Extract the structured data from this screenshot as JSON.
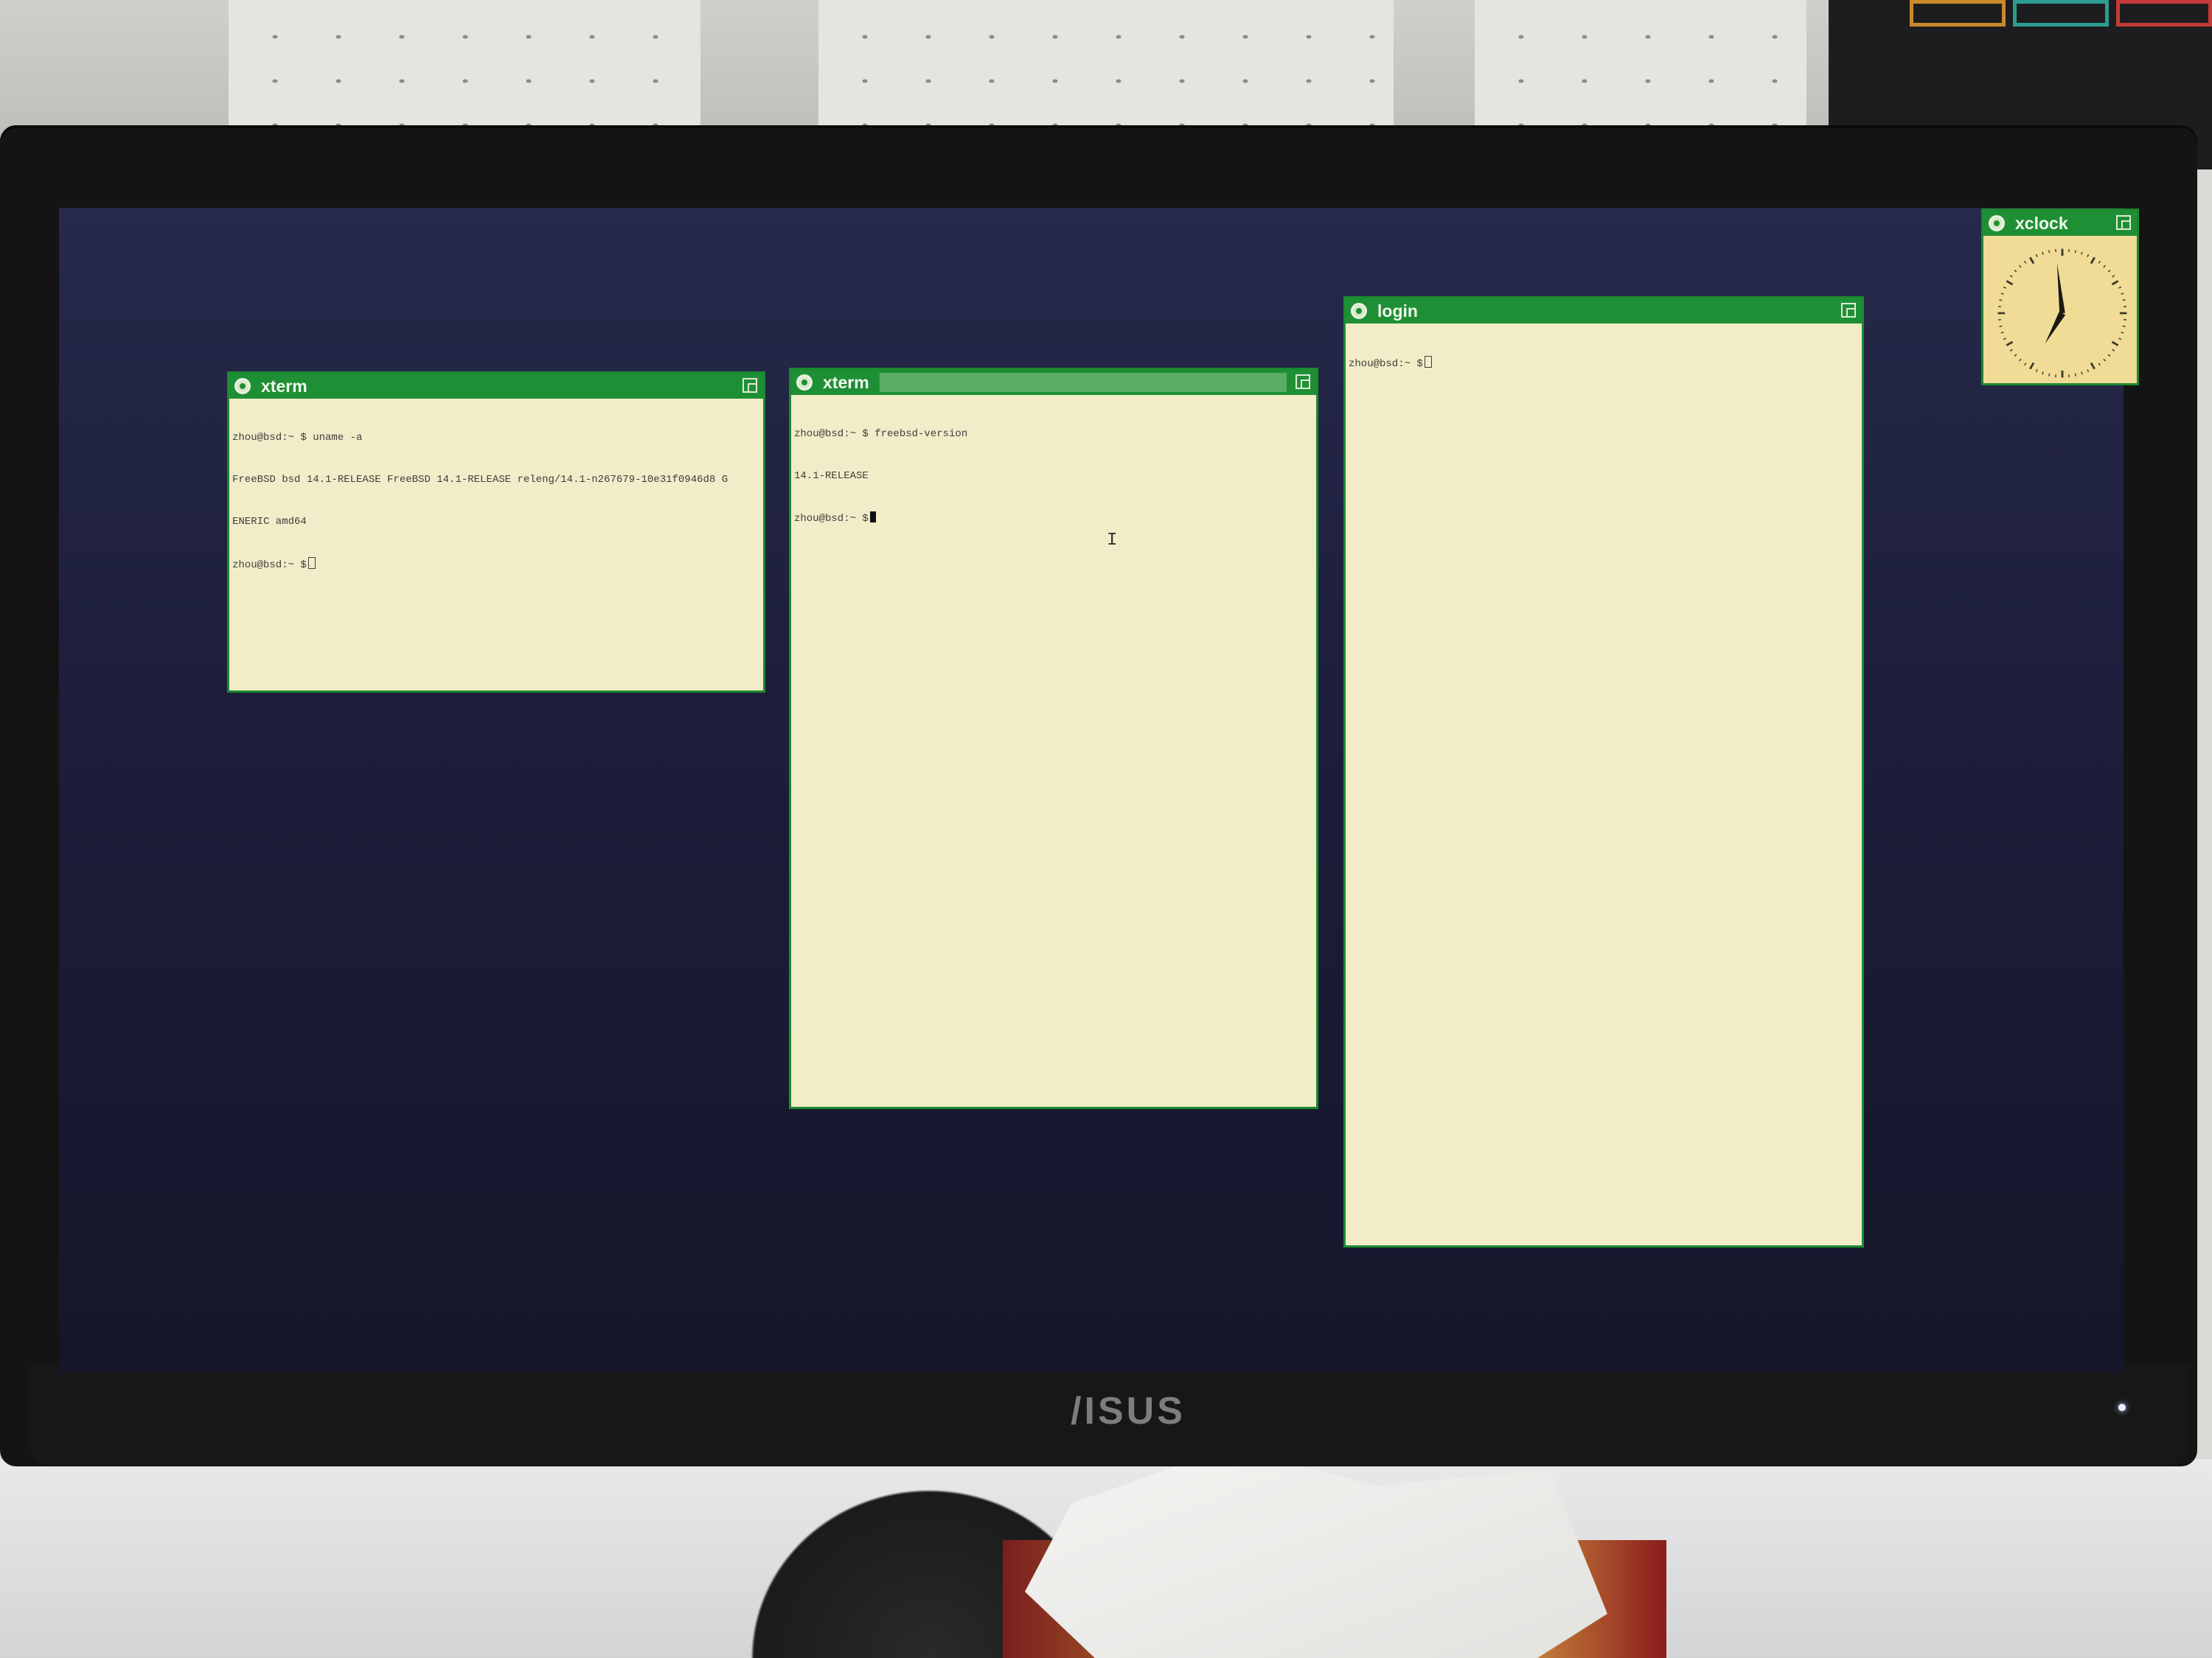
{
  "device": {
    "brand_logo": "/ISUS"
  },
  "windows": [
    {
      "id": "xterm-1",
      "title": "xterm",
      "lines": [
        "zhou@bsd:~ $ uname -a",
        "FreeBSD bsd 14.1-RELEASE FreeBSD 14.1-RELEASE releng/14.1-n267679-10e31f0946d8 G",
        "ENERIC amd64",
        "zhou@bsd:~ $"
      ]
    },
    {
      "id": "xterm-2",
      "title": "xterm",
      "lines": [
        "zhou@bsd:~ $ freebsd-version",
        "14.1-RELEASE",
        "zhou@bsd:~ $"
      ]
    },
    {
      "id": "login",
      "title": "login",
      "lines": [
        "zhou@bsd:~ $"
      ]
    },
    {
      "id": "xclock",
      "title": "xclock",
      "time": {
        "hour": 6,
        "minute": 59
      }
    }
  ],
  "colors": {
    "titlebar": "#1f8f36",
    "titlebar_active_fill": "#5aad63",
    "terminal_bg": "#f2ecc9",
    "clock_bg": "#f0dc96",
    "desktop": "#1c1e3a"
  }
}
